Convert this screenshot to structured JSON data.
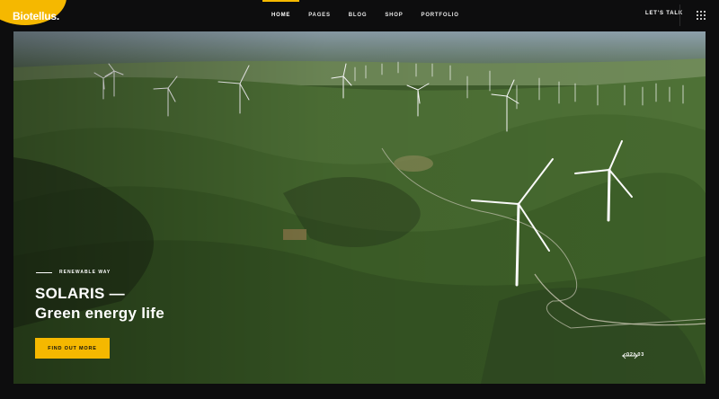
{
  "brand": {
    "logo_text": "Biotellus.",
    "accent": "#f5b800"
  },
  "nav": {
    "items": [
      {
        "label": "HOME",
        "active": true
      },
      {
        "label": "PAGES",
        "active": false
      },
      {
        "label": "BLOG",
        "active": false
      },
      {
        "label": "SHOP",
        "active": false
      },
      {
        "label": "PORTFOLIO",
        "active": false
      }
    ],
    "cta_label": "LET'S TALK",
    "menu_icon": "grid-menu-icon"
  },
  "hero": {
    "eyebrow": "RENEWABLE WAY",
    "headline_line1": "SOLARIS —",
    "headline_line2": "Green energy life",
    "button_label": "FIND OUT MORE",
    "slide_counter": "02/ 03",
    "prev_icon": "arrow-left-icon",
    "next_icon": "arrow-right-icon"
  }
}
